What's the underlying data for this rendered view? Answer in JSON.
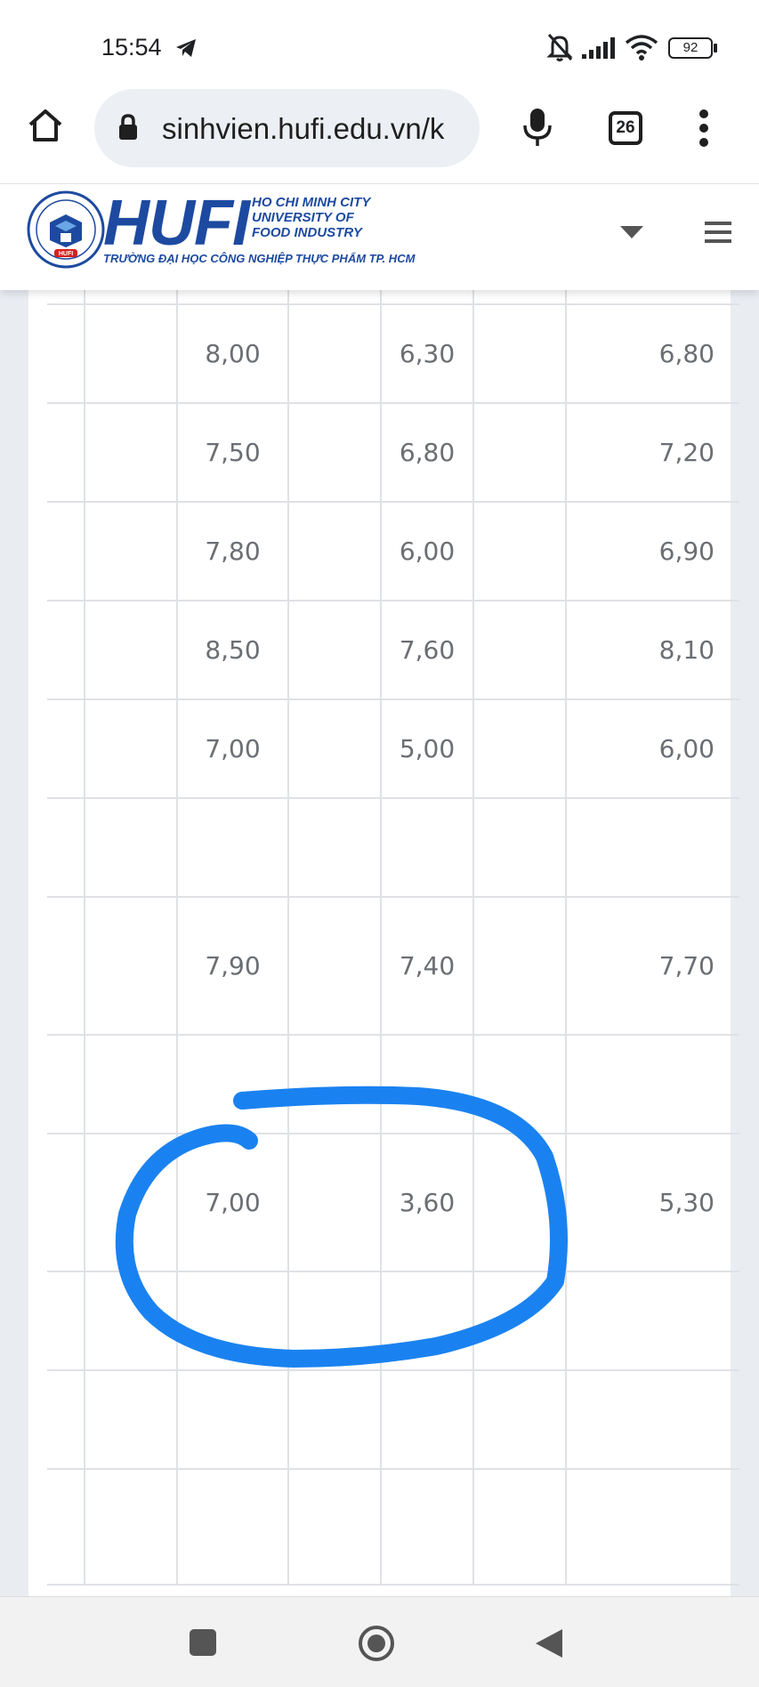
{
  "status_bar": {
    "time": "15:54",
    "battery": "92",
    "icons": [
      "telegram-icon",
      "mute-icon",
      "signal-icon",
      "wifi-icon",
      "battery-icon"
    ]
  },
  "browser": {
    "url": "sinhvien.hufi.edu.vn/k",
    "tab_count": "26",
    "icons": [
      "home-icon",
      "lock-icon",
      "mic-icon",
      "tabs-icon",
      "more-icon"
    ]
  },
  "site_header": {
    "logo_text": "HUFI",
    "logo_en_line1": "HO CHI MINH CITY",
    "logo_en_line2": "UNIVERSITY OF",
    "logo_en_line3": "FOOD INDUSTRY",
    "logo_vn": "TRƯỜNG ĐẠI HỌC CÔNG NGHIỆP THỰC PHẨM TP. HCM",
    "emblem_label": "HUFI",
    "icons": [
      "dropdown-icon",
      "hamburger-menu-icon"
    ]
  },
  "grades": {
    "rows": [
      {
        "c3": "",
        "c5": "",
        "c7": ""
      },
      {
        "c3": "8,00",
        "c5": "6,30",
        "c7": "6,80"
      },
      {
        "c3": "7,50",
        "c5": "6,80",
        "c7": "7,20"
      },
      {
        "c3": "7,80",
        "c5": "6,00",
        "c7": "6,90"
      },
      {
        "c3": "8,50",
        "c5": "7,60",
        "c7": "8,10"
      },
      {
        "c3": "7,00",
        "c5": "5,00",
        "c7": "6,00"
      },
      {
        "c3": "",
        "c5": "",
        "c7": ""
      },
      {
        "c3": "7,90",
        "c5": "7,40",
        "c7": "7,70"
      },
      {
        "c3": "",
        "c5": "",
        "c7": ""
      },
      {
        "c3": "7,00",
        "c5": "3,60",
        "c7": "5,30"
      },
      {
        "c3": "",
        "c5": "",
        "c7": ""
      },
      {
        "c3": "",
        "c5": "",
        "c7": ""
      },
      {
        "c3": "",
        "c5": "",
        "c7": ""
      }
    ]
  },
  "annotation": {
    "color": "#1a82f0",
    "shape": "hand-drawn circle"
  },
  "nav_bar": {
    "icons": [
      "recents-icon",
      "home-circle-icon",
      "back-icon"
    ]
  }
}
